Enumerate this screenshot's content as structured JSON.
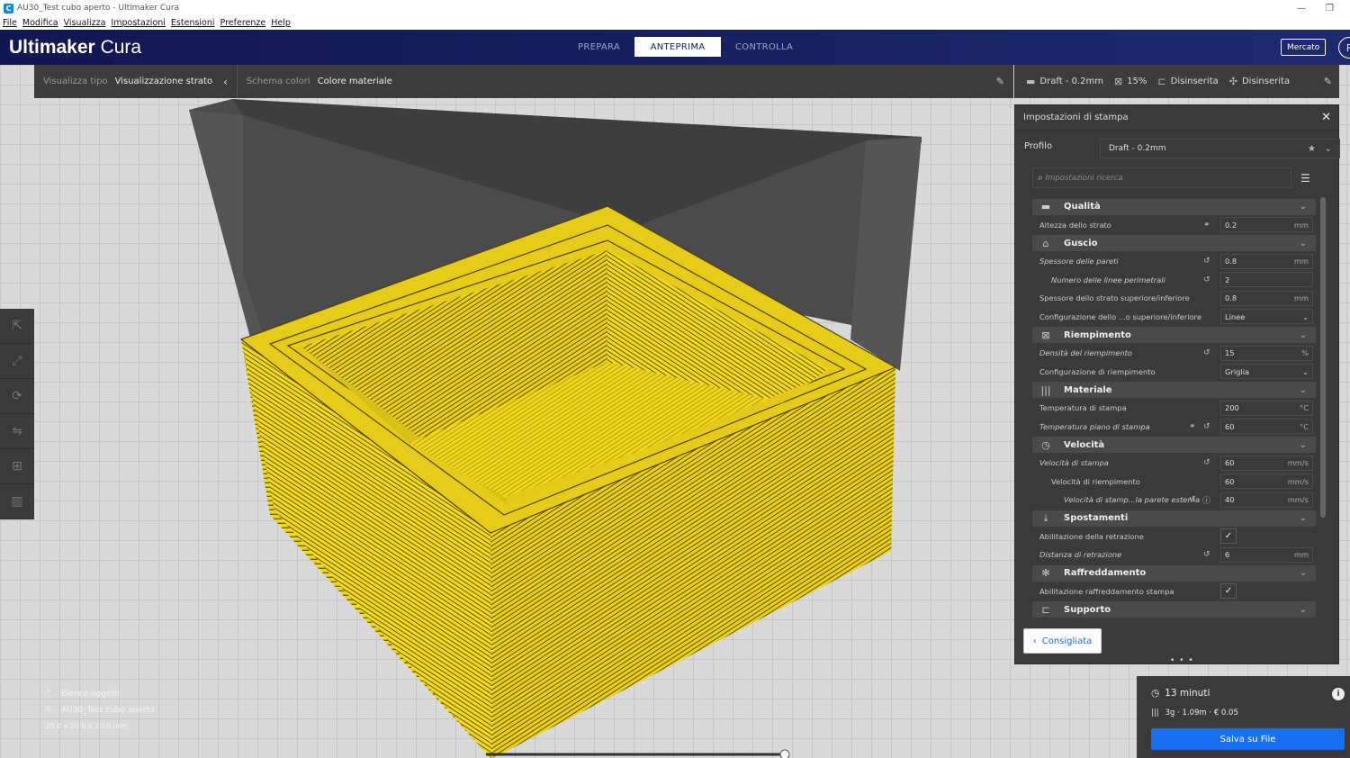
{
  "window": {
    "title": "AU30_Test cubo aperto - Ultimaker Cura",
    "app_icon": "C",
    "minimize": "—",
    "restore": "❐"
  },
  "menu": [
    "File",
    "Modifica",
    "Visualizza",
    "Impostazioni",
    "Estensioni",
    "Preferenze",
    "Help"
  ],
  "header": {
    "logo_bold": "Ultimaker",
    "logo_light": "Cura",
    "tabs": [
      {
        "label": "PREPARA",
        "active": false
      },
      {
        "label": "ANTEPRIMA",
        "active": true
      },
      {
        "label": "CONTROLLA",
        "active": false
      }
    ],
    "market": "Mercato",
    "account_initial": "F"
  },
  "view_toolbar": {
    "view_type_label": "Visualizza tipo",
    "view_type_value": "Visualizzazione strato",
    "color_scheme_label": "Schema colori",
    "color_scheme_value": "Colore materiale"
  },
  "print_summary": {
    "profile": "Draft - 0.2mm",
    "infill": "15%",
    "support": "Disinserita",
    "adhesion": "Disinserita"
  },
  "settings_panel": {
    "title": "Impostazioni di stampa",
    "profile_label": "Profilo",
    "profile_value": "Draft - 0.2mm",
    "search_placeholder": "Impostazioni ricerca",
    "categories": [
      {
        "name": "Qualità",
        "icon": "quality-icon",
        "glyph": "▬",
        "rows": [
          {
            "label": "Altezza dello strato",
            "value": "0.2",
            "unit": "mm",
            "icons": [
              "link"
            ],
            "italic": false,
            "indent": 0
          }
        ]
      },
      {
        "name": "Guscio",
        "icon": "shell-icon",
        "glyph": "⌂",
        "rows": [
          {
            "label": "Spessore delle pareti",
            "value": "0.8",
            "unit": "mm",
            "icons": [
              "reset"
            ],
            "italic": true,
            "indent": 0
          },
          {
            "label": "Numero delle linee perimetrali",
            "value": "2",
            "unit": "",
            "icons": [
              "reset"
            ],
            "italic": true,
            "indent": 1
          },
          {
            "label": "Spessore dello strato superiore/inferiore",
            "value": "0.8",
            "unit": "mm",
            "icons": [],
            "italic": false,
            "indent": 0
          },
          {
            "label": "Configurazione dello ...o superiore/inferiore",
            "value": "Linee",
            "unit": "⌄",
            "icons": [],
            "italic": false,
            "indent": 0,
            "dropdown": true
          }
        ]
      },
      {
        "name": "Riempimento",
        "icon": "infill-icon",
        "glyph": "⊠",
        "rows": [
          {
            "label": "Densità del riempimento",
            "value": "15",
            "unit": "%",
            "icons": [
              "reset"
            ],
            "italic": true,
            "indent": 0
          },
          {
            "label": "Configurazione di riempimento",
            "value": "Griglia",
            "unit": "⌄",
            "icons": [],
            "italic": false,
            "indent": 0,
            "dropdown": true
          }
        ]
      },
      {
        "name": "Materiale",
        "icon": "material-icon",
        "glyph": "|||",
        "rows": [
          {
            "label": "Temperatura di stampa",
            "value": "200",
            "unit": "°C",
            "icons": [],
            "italic": false,
            "indent": 0
          },
          {
            "label": "Temperatura piano di stampa",
            "value": "60",
            "unit": "°C",
            "icons": [
              "link",
              "reset"
            ],
            "italic": true,
            "indent": 0
          }
        ]
      },
      {
        "name": "Velocità",
        "icon": "speed-icon",
        "glyph": "◷",
        "rows": [
          {
            "label": "Velocità di stampa",
            "value": "60",
            "unit": "mm/s",
            "icons": [
              "reset"
            ],
            "italic": true,
            "indent": 0
          },
          {
            "label": "Velocità di riempimento",
            "value": "60",
            "unit": "mm/s",
            "icons": [],
            "italic": false,
            "indent": 1
          },
          {
            "label": "Velocità di stamp...la parete esterna",
            "value": "40",
            "unit": "mm/s",
            "icons": [
              "reset",
              "info"
            ],
            "italic": true,
            "indent": 2
          }
        ]
      },
      {
        "name": "Spostamenti",
        "icon": "travel-icon",
        "glyph": "⤓",
        "rows": [
          {
            "label": "Abilitazione della retrazione",
            "checkbox": true,
            "icons": [],
            "italic": false,
            "indent": 0
          },
          {
            "label": "Distanza di retrazione",
            "value": "6",
            "unit": "mm",
            "icons": [
              "reset"
            ],
            "italic": true,
            "indent": 0
          }
        ]
      },
      {
        "name": "Raffreddamento",
        "icon": "cooling-icon",
        "glyph": "✻",
        "rows": [
          {
            "label": "Abilitazione raffreddamento stampa",
            "checkbox": true,
            "icons": [],
            "italic": false,
            "indent": 0
          }
        ]
      },
      {
        "name": "Supporto",
        "icon": "support-icon",
        "glyph": "⊏",
        "rows": []
      }
    ],
    "recommended_button": "Consigliata",
    "grip": "• • •"
  },
  "object_list": {
    "title": "Elenco oggetti",
    "object_name": "AU30_Test cubo aperto",
    "dimensions": "20.0 x 20.0 x 20.0 mm"
  },
  "print_panel": {
    "time": "13 minuti",
    "material": "3g · 1.09m · € 0.05",
    "save_button": "Salva su File"
  },
  "colors": {
    "header": "#1b1f59",
    "panel": "#3a3a3a",
    "model": "#f2d81c",
    "accent": "#196ef0"
  }
}
